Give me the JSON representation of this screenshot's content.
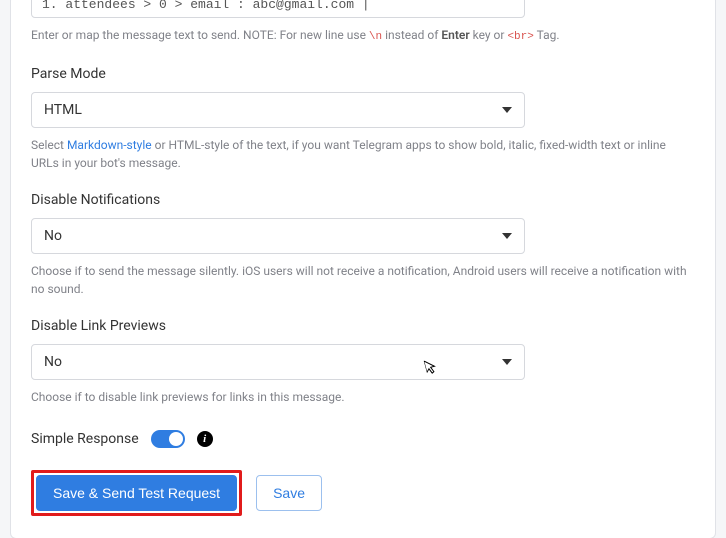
{
  "message_field": {
    "code_line": "1. attendees > 0 > email : abc@gmail.com |",
    "help_pre": "Enter or map the message text to send. NOTE: For new line use ",
    "help_code1": "\\n",
    "help_mid": " instead of ",
    "help_strong": "Enter",
    "help_mid2": " key or ",
    "help_code2": "<br>",
    "help_post": " Tag."
  },
  "parse_mode": {
    "label": "Parse Mode",
    "value": "HTML",
    "help_pre": "Select ",
    "help_link": "Markdown-style",
    "help_post": " or HTML-style of the text, if you want Telegram apps to show bold, italic, fixed-width text or inline URLs in your bot's message."
  },
  "disable_notifications": {
    "label": "Disable Notifications",
    "value": "No",
    "help": "Choose if to send the message silently. iOS users will not receive a notification, Android users will receive a notification with no sound."
  },
  "disable_link_previews": {
    "label": "Disable Link Previews",
    "value": "No",
    "help": "Choose if to disable link previews for links in this message."
  },
  "simple_response": {
    "label": "Simple Response"
  },
  "buttons": {
    "primary": "Save & Send Test Request",
    "secondary": "Save"
  }
}
